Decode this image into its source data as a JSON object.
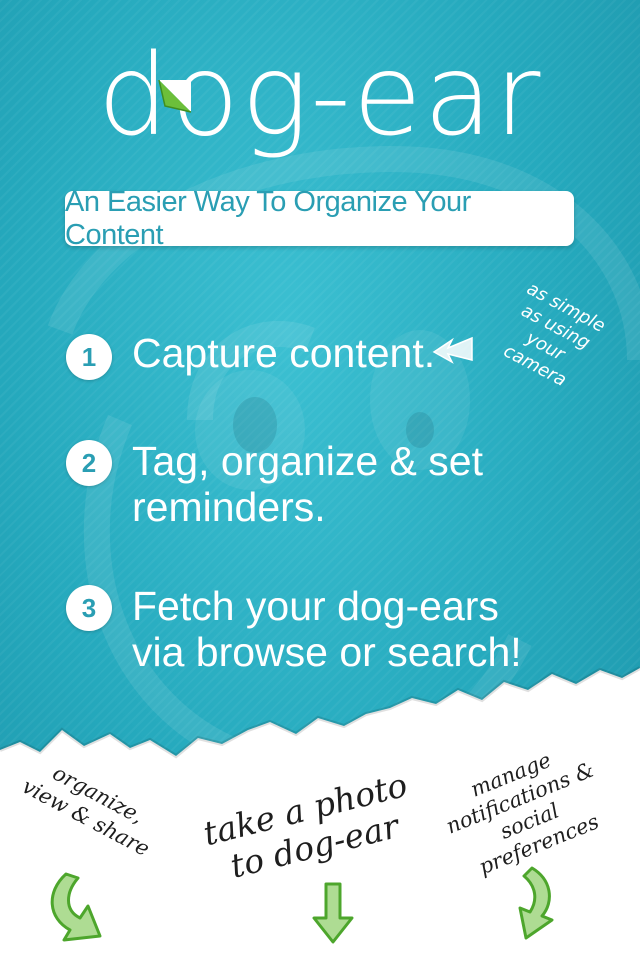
{
  "app": {
    "logo_text": "dog-ear",
    "tagline": "An Easier Way To Organize Your Content"
  },
  "steps": [
    {
      "number": "1",
      "text": "Capture content."
    },
    {
      "number": "2",
      "text": "Tag, organize & set reminders."
    },
    {
      "number": "3",
      "text": "Fetch your dog-ears via browse or search!"
    }
  ],
  "hint": {
    "text": "as simple\nas using\nyour\ncamera"
  },
  "bottom_notes": {
    "left": "organize,\nview & share",
    "center": "take a photo\nto dog-ear",
    "right": "manage\nnotifications &\nsocial\npreferences"
  },
  "icons": {
    "step_hint_arrow": "hand-drawn-arrow-icon",
    "bottom_arrows": "green-scribble-arrow-icon"
  },
  "colors": {
    "background": "#25a9bd",
    "accent_text": "#2a9eb3",
    "green_fold": "#6cbf3a",
    "paper": "#ffffff"
  }
}
